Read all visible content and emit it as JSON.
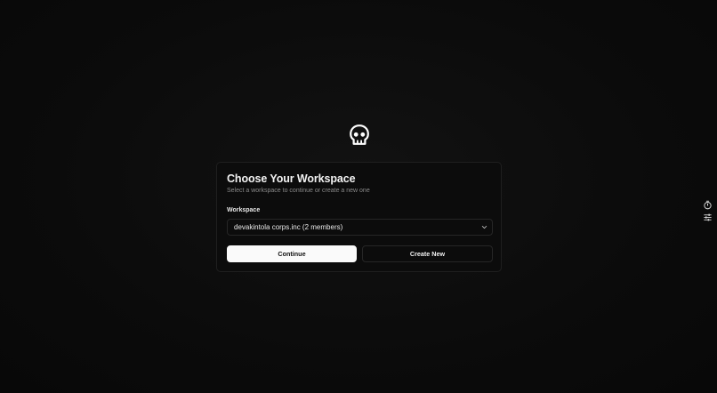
{
  "logo": {
    "icon": "skull-icon"
  },
  "card": {
    "title": "Choose Your Workspace",
    "subtitle": "Select a workspace to continue or create a new one",
    "workspace_label": "Workspace",
    "workspace_selected": "devakintola corps.inc (2 members)",
    "continue_label": "Continue",
    "create_label": "Create New"
  },
  "side_tools": [
    {
      "icon": "timer-icon"
    },
    {
      "icon": "sliders-icon"
    }
  ],
  "colors": {
    "background": "#0b0b0b",
    "card_border": "#1f1f1f",
    "primary_button": "#fafafa",
    "muted_text": "#8a8a8a"
  }
}
